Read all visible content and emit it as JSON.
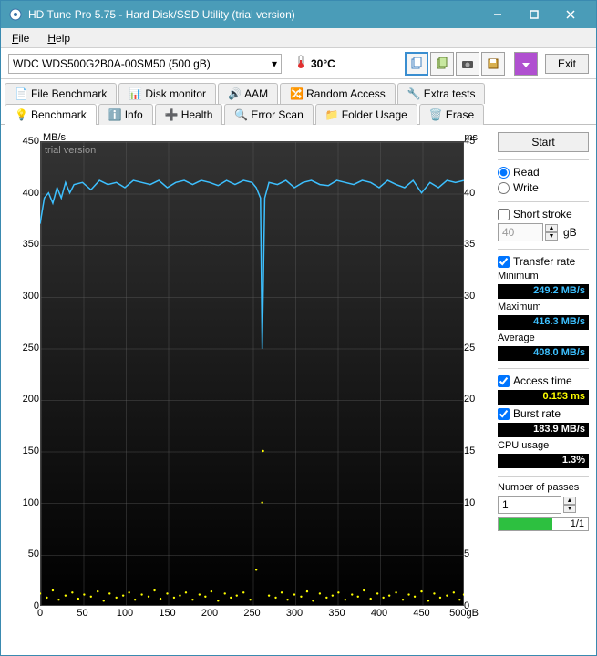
{
  "titlebar": {
    "title": "HD Tune Pro 5.75 - Hard Disk/SSD Utility (trial version)"
  },
  "menubar": {
    "file": "File",
    "help": "Help"
  },
  "toolbar": {
    "drive": "WDC WDS500G2B0A-00SM50 (500 gB)",
    "temp": "30°C",
    "exit": "Exit"
  },
  "tabs": {
    "row1": [
      "File Benchmark",
      "Disk monitor",
      "AAM",
      "Random Access",
      "Extra tests"
    ],
    "row2": [
      "Benchmark",
      "Info",
      "Health",
      "Error Scan",
      "Folder Usage",
      "Erase"
    ],
    "active": "Benchmark"
  },
  "side": {
    "start": "Start",
    "read": "Read",
    "write": "Write",
    "short_stroke": "Short stroke",
    "short_stroke_val": "40",
    "short_stroke_unit": "gB",
    "transfer_rate": "Transfer rate",
    "minimum": "Minimum",
    "minimum_val": "249.2 MB/s",
    "maximum": "Maximum",
    "maximum_val": "416.3 MB/s",
    "average": "Average",
    "average_val": "408.0 MB/s",
    "access_time": "Access time",
    "access_time_val": "0.153 ms",
    "burst_rate": "Burst rate",
    "burst_rate_val": "183.9 MB/s",
    "cpu_usage": "CPU usage",
    "cpu_usage_val": "1.3%",
    "passes": "Number of passes",
    "passes_val": "1",
    "progress_txt": "1/1"
  },
  "chart_data": {
    "type": "line",
    "title": "",
    "watermark": "trial version",
    "y_left": {
      "label": "MB/s",
      "min": 0,
      "max": 450,
      "step": 50
    },
    "y_right": {
      "label": "ms",
      "min": 0,
      "max": 45,
      "step": 5
    },
    "x": {
      "label": "gB",
      "min": 0,
      "max": 500,
      "step": 50
    },
    "series": [
      {
        "name": "Transfer rate",
        "color": "#3dc0ff",
        "axis": "left",
        "x": [
          0,
          5,
          10,
          15,
          20,
          25,
          30,
          35,
          40,
          50,
          60,
          70,
          80,
          90,
          100,
          110,
          120,
          130,
          140,
          150,
          160,
          170,
          180,
          190,
          200,
          210,
          220,
          230,
          240,
          250,
          255,
          260,
          262,
          265,
          270,
          280,
          290,
          300,
          310,
          320,
          330,
          340,
          350,
          360,
          370,
          380,
          390,
          400,
          410,
          420,
          430,
          440,
          450,
          460,
          470,
          480,
          490,
          500
        ],
        "values": [
          370,
          395,
          400,
          390,
          405,
          395,
          410,
          400,
          408,
          410,
          403,
          412,
          408,
          410,
          405,
          412,
          410,
          408,
          412,
          405,
          410,
          412,
          408,
          412,
          410,
          407,
          412,
          408,
          412,
          410,
          405,
          395,
          249,
          395,
          410,
          408,
          412,
          405,
          410,
          412,
          408,
          407,
          412,
          410,
          408,
          412,
          410,
          405,
          412,
          408,
          405,
          412,
          400,
          410,
          405,
          412,
          410,
          412
        ]
      },
      {
        "name": "Access time",
        "color": "#ffff00",
        "axis": "right",
        "type": "scatter",
        "x": [
          0,
          8,
          15,
          22,
          30,
          38,
          45,
          52,
          60,
          68,
          75,
          82,
          90,
          98,
          105,
          112,
          120,
          128,
          135,
          142,
          150,
          158,
          165,
          172,
          180,
          188,
          195,
          202,
          210,
          218,
          225,
          232,
          240,
          248,
          255,
          262,
          263,
          270,
          278,
          285,
          292,
          300,
          308,
          315,
          322,
          330,
          338,
          345,
          352,
          360,
          368,
          375,
          382,
          390,
          398,
          405,
          412,
          420,
          428,
          435,
          442,
          450,
          458,
          465,
          472,
          480,
          488,
          495,
          500
        ],
        "values": [
          1.2,
          0.8,
          1.5,
          0.6,
          1.0,
          1.3,
          0.7,
          1.1,
          0.9,
          1.4,
          0.5,
          1.2,
          0.8,
          1.0,
          1.3,
          0.6,
          1.1,
          0.9,
          1.5,
          0.7,
          1.2,
          0.8,
          1.0,
          1.3,
          0.6,
          1.1,
          0.9,
          1.4,
          0.5,
          1.2,
          0.8,
          1.0,
          1.3,
          0.6,
          3.5,
          10.0,
          15.0,
          1.0,
          0.8,
          1.3,
          0.6,
          1.1,
          0.9,
          1.4,
          0.5,
          1.2,
          0.8,
          1.0,
          1.3,
          0.6,
          1.1,
          0.9,
          1.5,
          0.7,
          1.2,
          0.8,
          1.0,
          1.3,
          0.6,
          1.1,
          0.9,
          1.4,
          0.5,
          1.2,
          0.8,
          1.0,
          1.3,
          0.6,
          1.1
        ]
      }
    ]
  }
}
